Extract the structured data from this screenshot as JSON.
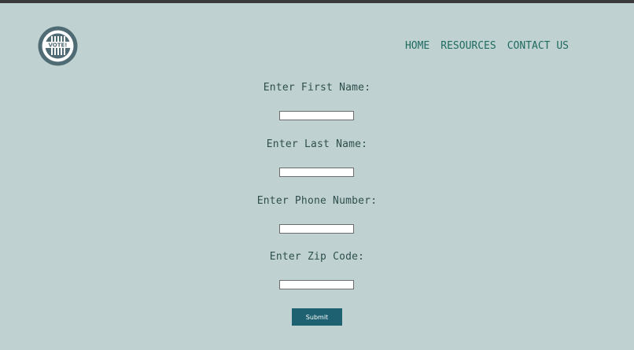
{
  "logo": {
    "text": "VOTE!",
    "icon": "vote-badge-icon"
  },
  "nav": {
    "items": [
      "HOME",
      "RESOURCES",
      "CONTACT US"
    ]
  },
  "form": {
    "first_name_label": "Enter First Name:",
    "last_name_label": "Enter Last Name:",
    "phone_label": "Enter Phone Number:",
    "zip_label": "Enter Zip Code:",
    "first_name_value": "",
    "last_name_value": "",
    "phone_value": "",
    "zip_value": "",
    "submit_label": "Submit"
  },
  "colors": {
    "background": "#bfd1d0",
    "nav_text": "#1f6b62",
    "label_text": "#2f4f4f",
    "button_bg": "#1e6170",
    "logo_color": "#4f6b74"
  }
}
